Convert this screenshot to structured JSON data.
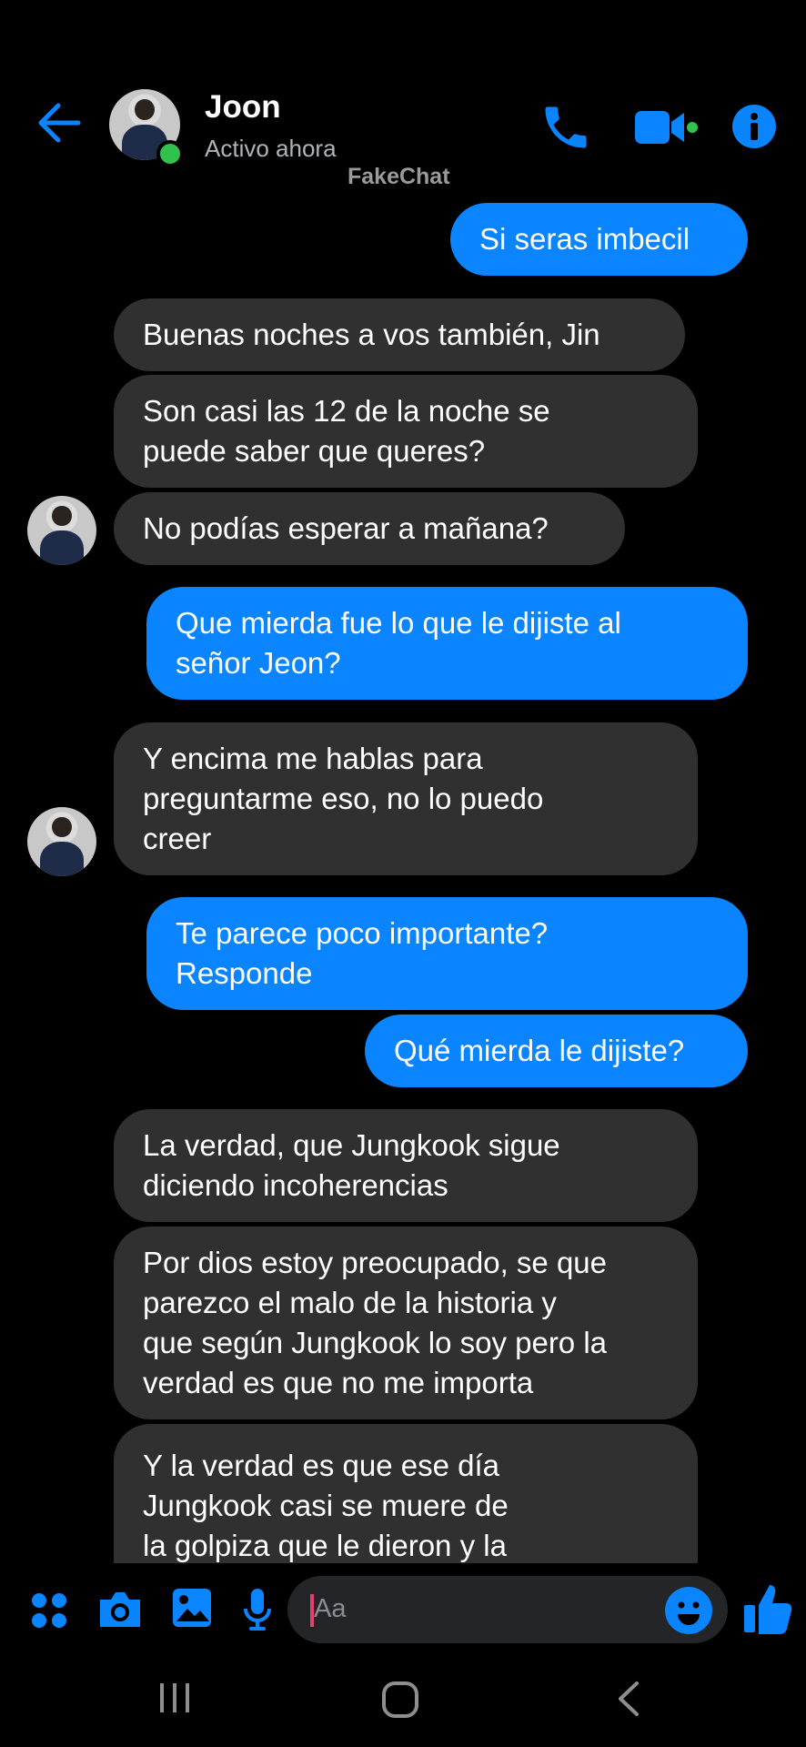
{
  "header": {
    "contact_name": "Joon",
    "status": "Activo ahora",
    "watermark": "FakeChat"
  },
  "messages": [
    {
      "from": "me",
      "text": "Si seras imbecil"
    },
    {
      "from": "them",
      "text": "Buenas noches a vos también, Jin"
    },
    {
      "from": "them",
      "text": "Son casi las 12 de la noche se\npuede saber que queres?"
    },
    {
      "from": "them",
      "text": "No podías esperar a mañana?"
    },
    {
      "from": "me",
      "text": "Que mierda fue lo que le dijiste al\nseñor Jeon?"
    },
    {
      "from": "them",
      "text": "Y encima me hablas para\npreguntarme eso, no lo puedo\ncreer"
    },
    {
      "from": "me",
      "text": "Te parece poco importante?\nResponde"
    },
    {
      "from": "me",
      "text": "Qué mierda le dijiste?"
    },
    {
      "from": "them",
      "text": "La verdad, que Jungkook sigue\ndiciendo incoherencias"
    },
    {
      "from": "them",
      "text": "Por dios estoy preocupado, se que\nparezco el malo de la historia y\nque según Jungkook lo soy pero la\nverdad es que no me importa"
    },
    {
      "from": "them",
      "text": "Y la verdad es que ese día\nJungkook casi se muere de\nla golpiza que le dieron y la"
    }
  ],
  "composer": {
    "placeholder": "Aa"
  },
  "colors": {
    "accent": "#0a84ff",
    "incoming_bubble": "#303030",
    "online": "#31c24d"
  }
}
